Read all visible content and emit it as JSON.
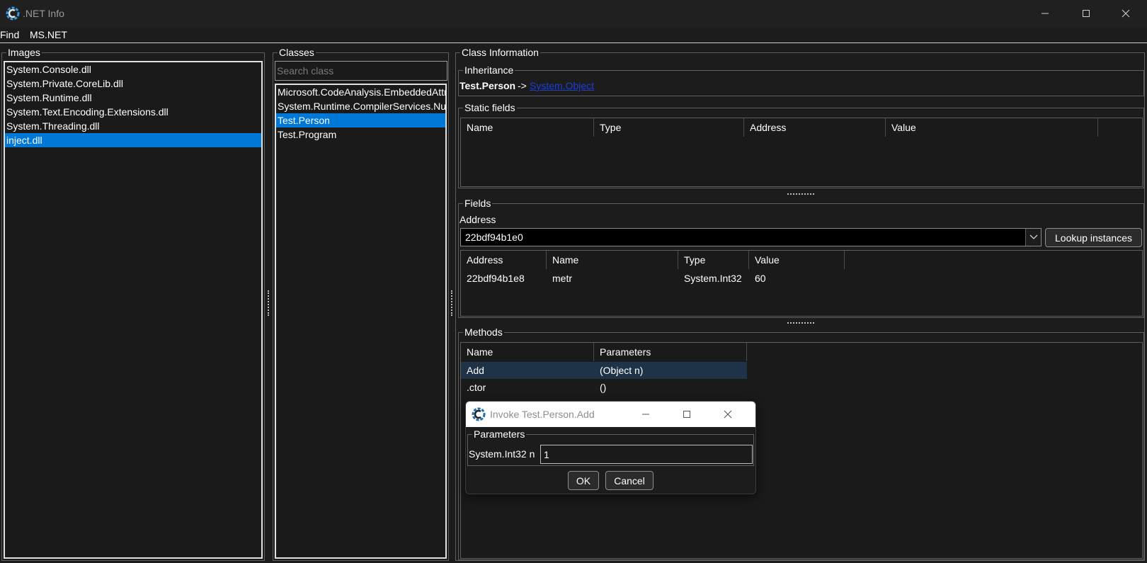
{
  "window": {
    "title": ".NET Info"
  },
  "menu": {
    "items": [
      "Find",
      "MS.NET"
    ]
  },
  "images": {
    "title": "Images",
    "items": [
      "System.Console.dll",
      "System.Private.CoreLib.dll",
      "System.Runtime.dll",
      "System.Text.Encoding.Extensions.dll",
      "System.Threading.dll",
      "inject.dll"
    ],
    "selected_index": 5
  },
  "classes": {
    "title": "Classes",
    "search_placeholder": "Search class",
    "items": [
      "Microsoft.CodeAnalysis.EmbeddedAttribute",
      "System.Runtime.CompilerServices.NullableAttribute",
      "Test.Person",
      "Test.Program"
    ],
    "selected_index": 2
  },
  "class_info": {
    "title": "Class Information",
    "inheritance": {
      "title": "Inheritance",
      "class_name": "Test.Person",
      "arrow": "->",
      "base": "System.Object"
    },
    "static_fields": {
      "title": "Static fields",
      "columns": [
        "Name",
        "Type",
        "Address",
        "Value"
      ],
      "rows": []
    },
    "fields": {
      "title": "Fields",
      "address_label": "Address",
      "address_value": "22bdf94b1e0",
      "lookup_button": "Lookup instances",
      "columns": [
        "Address",
        "Name",
        "Type",
        "Value"
      ],
      "rows": [
        [
          "22bdf94b1e8",
          "metr",
          "System.Int32",
          "60"
        ]
      ]
    },
    "methods": {
      "title": "Methods",
      "columns": [
        "Name",
        "Parameters"
      ],
      "rows": [
        [
          "Add",
          "(Object  n)"
        ],
        [
          ".ctor",
          "()"
        ]
      ],
      "selected_index": 0
    }
  },
  "dialog": {
    "title": "Invoke Test.Person.Add",
    "group_title": "Parameters",
    "param_label": "System.Int32 n",
    "param_value": "1",
    "ok": "OK",
    "cancel": "Cancel"
  },
  "colors": {
    "selection": "#0078d7",
    "method_selection": "#1f3348",
    "link": "#1a3fd9",
    "background": "#1c1c1c"
  }
}
